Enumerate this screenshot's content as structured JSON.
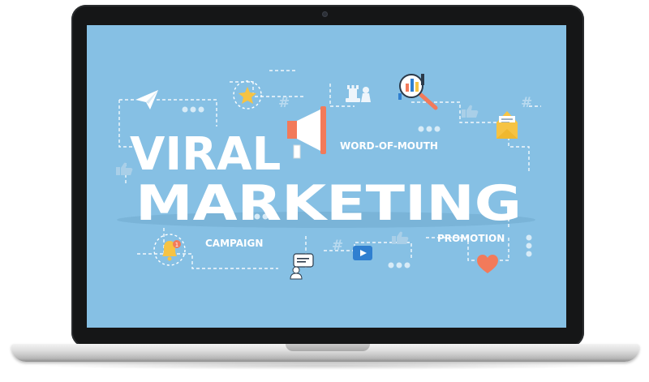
{
  "headline": {
    "line1": "VIRAL",
    "line2": "MARKETING"
  },
  "tags": {
    "word_of_mouth": "WORD-OF-MOUTH",
    "campaign": "CAMPAIGN",
    "promotion": "PROMOTION"
  },
  "notification_badge": "1",
  "decor": {
    "hash_symbol": "#"
  },
  "colors": {
    "screen_background": "#86c0e4",
    "accent_orange": "#f27a5a",
    "accent_yellow": "#f6c343",
    "accent_blue": "#2f7fd0",
    "text": "#ffffff"
  },
  "icons": [
    "paper-plane-icon",
    "star-icon",
    "chess-rook-icon",
    "chess-pawn-icon",
    "magnifier-chart-icon",
    "megaphone-icon",
    "envelope-icon",
    "thumbs-up-icon",
    "bell-icon",
    "video-play-icon",
    "chat-person-icon",
    "heart-icon"
  ]
}
